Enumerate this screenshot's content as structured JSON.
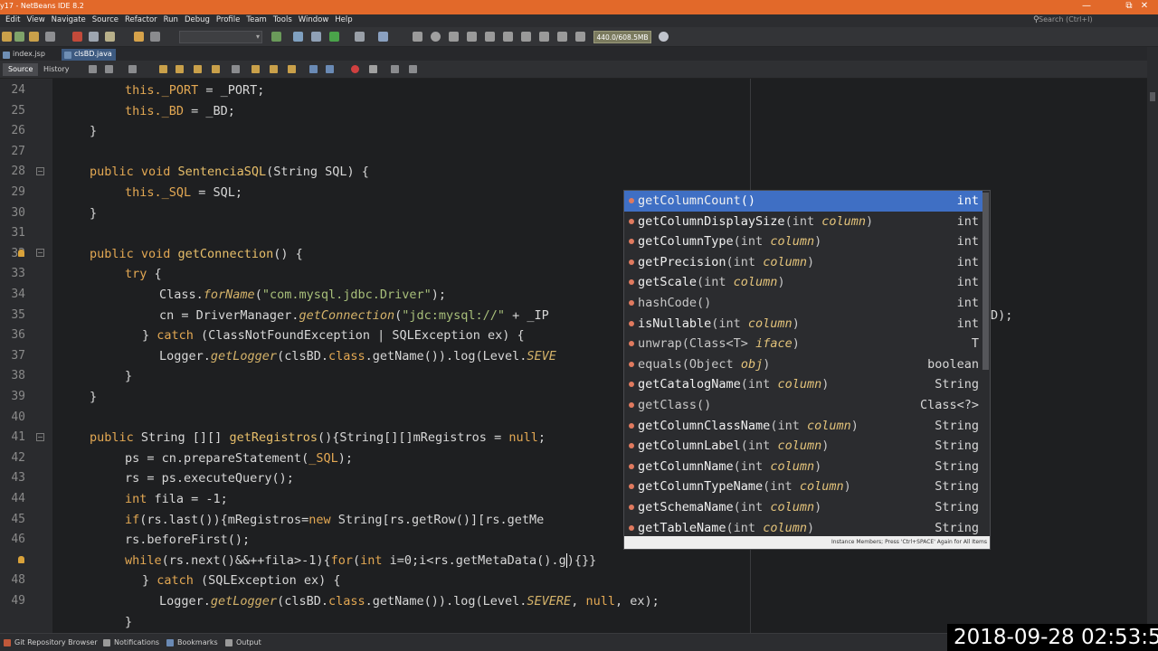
{
  "window": {
    "title": "y17 - NetBeans IDE 8.2",
    "minimize": "—",
    "restore": "⧉",
    "close": "✕"
  },
  "menu": [
    "Edit",
    "View",
    "Navigate",
    "Source",
    "Refactor",
    "Run",
    "Debug",
    "Profile",
    "Team",
    "Tools",
    "Window",
    "Help"
  ],
  "search": {
    "placeholder": "Search (Ctrl+I)"
  },
  "toolbar": {
    "memory": "440.0/608.5MB"
  },
  "tabs": [
    {
      "label": "index.jsp"
    },
    {
      "label": "clsBD.java"
    }
  ],
  "editor_tabs": {
    "source": "Source",
    "history": "History"
  },
  "code": {
    "lines": [
      "24",
      "25",
      "26",
      "27",
      "28",
      "29",
      "30",
      "31",
      "32",
      "33",
      "34",
      "35",
      "36",
      "37",
      "38",
      "39",
      "40",
      "41",
      "42",
      "43",
      "44",
      "45",
      "46",
      "47",
      "48",
      "49"
    ],
    "l24": {
      "a": "this.",
      "b": "_PORT",
      "c": " = _PORT;"
    },
    "l25": {
      "a": "this.",
      "b": "_BD",
      "c": " = _BD;"
    },
    "l26": "}",
    "l28": {
      "a": "public void ",
      "b": "SentenciaSQL",
      "c": "(String SQL) {"
    },
    "l29": {
      "a": "this.",
      "b": "_SQL",
      "c": " = SQL;"
    },
    "l30": "}",
    "l32": {
      "a": "public void ",
      "b": "getConnection",
      "c": "() {"
    },
    "l33": {
      "a": "try",
      "c": " {"
    },
    "l34": {
      "a": "Class.",
      "b": "forName",
      "c": "(",
      "d": "\"com.mysql.jdbc.Driver\"",
      "e": ");"
    },
    "l35": {
      "a": "cn = DriverManager.",
      "b": "getConnection",
      "c": "(",
      "d": "\"jdc:mysql://\"",
      "e": " + _IP"
    },
    "l35_tail": "D);",
    "l36": {
      "a": "} ",
      "b": "catch",
      "c": " (ClassNotFoundException | SQLException ex) {"
    },
    "l37": {
      "a": "Logger.",
      "b": "getLogger",
      "c": "(clsBD.",
      "d": "class",
      "e": ".getName()).log(Level.",
      "f": "SEVE"
    },
    "l38": "}",
    "l39": "}",
    "l41": {
      "a": "public ",
      "b": "String [][] ",
      "c": "getRegistros",
      "d": "(){String[][]mRegistros = ",
      "e": "null",
      "f": ";"
    },
    "l42": {
      "a": "ps = cn.prepareStatement(",
      "b": "_SQL",
      "c": ");"
    },
    "l43": {
      "a": "rs = ps.executeQuery();"
    },
    "l44": {
      "a": "int",
      "b": " fila = -1;"
    },
    "l45": {
      "a": "if",
      "b": "(rs.last()){mRegistros=",
      "c": "new",
      "d": " String[rs.getRow()][rs.getMe"
    },
    "l46": {
      "a": "rs.beforeFirst();"
    },
    "l47": {
      "a": "while",
      "b": "(rs.next()&&++fila>-1){",
      "c": "for",
      "d": "(",
      "e": "int",
      "f": " i=0;i<rs.getMetaData().g",
      "g": "){}}"
    },
    "l48": {
      "a": "} ",
      "b": "catch",
      "c": " (SQLException ex) {"
    },
    "l49": {
      "a": "Logger.",
      "b": "getLogger",
      "c": "(clsBD.",
      "d": "class",
      "e": ".getName()).log(Level.",
      "f": "SEVERE",
      "g": ", ",
      "h": "null",
      "i": ", ex);"
    },
    "l50": "}"
  },
  "completion": {
    "items": [
      {
        "name": "getColumnCount",
        "params": "()",
        "pv": "",
        "pe": "",
        "type": "int",
        "bold": true
      },
      {
        "name": "getColumnDisplaySize",
        "params": "(int ",
        "pv": "column",
        "pe": ")",
        "type": "int",
        "bold": true
      },
      {
        "name": "getColumnType",
        "params": "(int ",
        "pv": "column",
        "pe": ")",
        "type": "int",
        "bold": true
      },
      {
        "name": "getPrecision",
        "params": "(int ",
        "pv": "column",
        "pe": ")",
        "type": "int",
        "bold": true
      },
      {
        "name": "getScale",
        "params": "(int ",
        "pv": "column",
        "pe": ")",
        "type": "int",
        "bold": true
      },
      {
        "name": "hashCode",
        "params": "()",
        "pv": "",
        "pe": "",
        "type": "int",
        "bold": false
      },
      {
        "name": "isNullable",
        "params": "(int ",
        "pv": "column",
        "pe": ")",
        "type": "int",
        "bold": true
      },
      {
        "name": "unwrap",
        "params": "(Class<T> ",
        "pv": "iface",
        "pe": ")",
        "type": "T",
        "bold": false
      },
      {
        "name": "equals",
        "params": "(Object ",
        "pv": "obj",
        "pe": ")",
        "type": "boolean",
        "bold": false
      },
      {
        "name": "getCatalogName",
        "params": "(int ",
        "pv": "column",
        "pe": ")",
        "type": "String",
        "bold": true
      },
      {
        "name": "getClass",
        "params": "()",
        "pv": "",
        "pe": "",
        "type": "Class<?>",
        "bold": false
      },
      {
        "name": "getColumnClassName",
        "params": "(int ",
        "pv": "column",
        "pe": ")",
        "type": "String",
        "bold": true
      },
      {
        "name": "getColumnLabel",
        "params": "(int ",
        "pv": "column",
        "pe": ")",
        "type": "String",
        "bold": true
      },
      {
        "name": "getColumnName",
        "params": "(int ",
        "pv": "column",
        "pe": ")",
        "type": "String",
        "bold": true
      },
      {
        "name": "getColumnTypeName",
        "params": "(int ",
        "pv": "column",
        "pe": ")",
        "type": "String",
        "bold": true
      },
      {
        "name": "getSchemaName",
        "params": "(int ",
        "pv": "column",
        "pe": ")",
        "type": "String",
        "bold": true
      },
      {
        "name": "getTableName",
        "params": "(int ",
        "pv": "column",
        "pe": ")",
        "type": "String",
        "bold": true
      }
    ],
    "footer": "Instance Members; Press 'Ctrl+SPACE' Again for All Items"
  },
  "status": {
    "git": "Git Repository Browser",
    "notifications": "Notifications",
    "bookmarks": "Bookmarks",
    "output": "Output"
  },
  "timestamp": "2018-09-28 02:53:5",
  "colors": {
    "titlebar": "#e2692a",
    "selection": "#3f6fc4",
    "keyword": "#e3a853",
    "string": "#a8bf7a"
  }
}
